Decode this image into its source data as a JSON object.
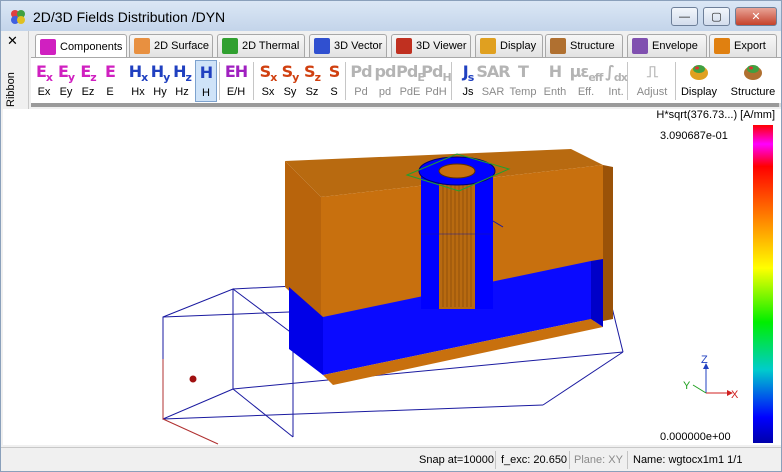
{
  "window": {
    "title": "2D/3D Fields Distribution /DYN",
    "buttons": {
      "minimize": "—",
      "maximize": "▢",
      "close": "✕"
    }
  },
  "ribbon": {
    "close": "✕",
    "label": "Ribbon"
  },
  "tabs": [
    {
      "label": "Components",
      "icon": "field-e-icon",
      "color": "#d020c0",
      "active": true
    },
    {
      "label": "2D Surface",
      "icon": "surface-2d-icon",
      "color": "#e89040"
    },
    {
      "label": "2D Thermal",
      "icon": "thermal-2d-icon",
      "color": "#30a030"
    },
    {
      "label": "3D Vector",
      "icon": "vector-3d-icon",
      "color": "#3050d0"
    },
    {
      "label": "3D Viewer",
      "icon": "viewer-3d-icon",
      "color": "#c03020"
    },
    {
      "label": "Display",
      "icon": "display-icon",
      "color": "#e0a020"
    },
    {
      "label": "Structure",
      "icon": "structure-icon",
      "color": "#b07030"
    },
    {
      "label": "Envelope",
      "icon": "envelope-icon",
      "color": "#8050b0"
    },
    {
      "label": "Export",
      "icon": "export-icon",
      "color": "#e08010"
    }
  ],
  "toolbar": [
    {
      "label": "Ex",
      "glyph": "E",
      "sub": "x",
      "color": "#d020c0"
    },
    {
      "label": "Ey",
      "glyph": "E",
      "sub": "y",
      "color": "#d020c0"
    },
    {
      "label": "Ez",
      "glyph": "E",
      "sub": "z",
      "color": "#d020c0"
    },
    {
      "label": "E",
      "glyph": "E",
      "sub": "",
      "color": "#d020c0"
    },
    {
      "label": "Hx",
      "glyph": "H",
      "sub": "x",
      "color": "#2040c0"
    },
    {
      "label": "Hy",
      "glyph": "H",
      "sub": "y",
      "color": "#2040c0"
    },
    {
      "label": "Hz",
      "glyph": "H",
      "sub": "z",
      "color": "#2040c0"
    },
    {
      "label": "H",
      "glyph": "H",
      "sub": "",
      "color": "#2040c0",
      "pressed": true
    },
    {
      "label": "E/H",
      "glyph": "EH",
      "sub": "",
      "color": "#a020c0"
    },
    {
      "label": "Sx",
      "glyph": "S",
      "sub": "x",
      "color": "#d04010"
    },
    {
      "label": "Sy",
      "glyph": "S",
      "sub": "y",
      "color": "#d04010"
    },
    {
      "label": "Sz",
      "glyph": "S",
      "sub": "z",
      "color": "#d04010"
    },
    {
      "label": "S",
      "glyph": "S",
      "sub": "",
      "color": "#d04010"
    },
    {
      "label": "Pd",
      "glyph": "Pd",
      "sub": "",
      "disabled": true
    },
    {
      "label": "pd",
      "glyph": "pd",
      "sub": "",
      "disabled": true
    },
    {
      "label": "PdE",
      "glyph": "Pd",
      "sub": "E",
      "disabled": true
    },
    {
      "label": "PdH",
      "glyph": "Pd",
      "sub": "H",
      "disabled": true
    },
    {
      "label": "Js",
      "glyph": "J",
      "sub": "s",
      "color": "#2040c0"
    },
    {
      "label": "SAR",
      "glyph": "SAR",
      "sub": "",
      "disabled": true
    },
    {
      "label": "Temp",
      "glyph": "T",
      "sub": "",
      "disabled": true
    },
    {
      "label": "Enth",
      "glyph": "H",
      "sub": "",
      "disabled": true
    },
    {
      "label": "Eff.",
      "glyph": "με",
      "sub": "eff",
      "disabled": true
    },
    {
      "label": "Int.",
      "glyph": "∫",
      "sub": "dx",
      "disabled": true
    },
    {
      "label": "Adjust",
      "glyph": "⎍",
      "sub": "",
      "disabled": true
    },
    {
      "label": "Display",
      "glyph": "",
      "sub": "",
      "color": "#e0a020",
      "icon": "display-big-icon"
    },
    {
      "label": "Structure",
      "glyph": "",
      "sub": "",
      "color": "#b07030",
      "icon": "structure-big-icon"
    }
  ],
  "view": {
    "legend_title": "H*sqrt(376.73...) [A/mm]",
    "legend_max": "3.090687e-01",
    "legend_min": "0.000000e+00",
    "axes": {
      "x": "X",
      "y": "Y",
      "z": "Z"
    },
    "colors": {
      "copper": "#c8700e",
      "field": "#0000ff",
      "outline": "#1a1aa0"
    }
  },
  "status": {
    "snap": "Snap at=10000",
    "f_exc": "f_exc: 20.650",
    "plane": "Plane: XY",
    "name": "Name: wgtocx1m1 1/1"
  }
}
